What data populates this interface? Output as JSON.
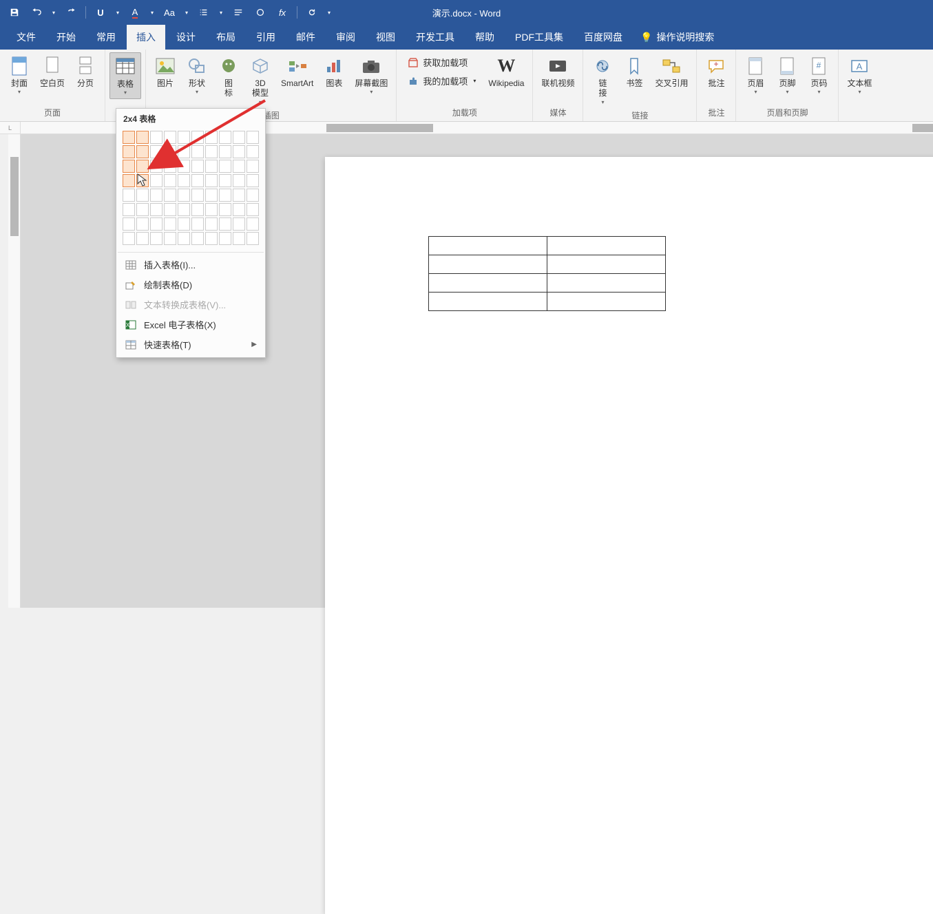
{
  "title": "演示.docx - Word",
  "qat_tooltips": {
    "save": "保存",
    "undo": "撤销",
    "redo": "重做"
  },
  "tabs": {
    "file": "文件",
    "home": "开始",
    "common": "常用",
    "insert": "插入",
    "design": "设计",
    "layout": "布局",
    "references": "引用",
    "mail": "邮件",
    "review": "审阅",
    "view": "视图",
    "developer": "开发工具",
    "help": "帮助",
    "pdf": "PDF工具集",
    "baidu": "百度网盘",
    "tellme": "操作说明搜索"
  },
  "ribbon": {
    "pages": {
      "cover": "封面",
      "blank": "空白页",
      "break": "分页",
      "group": "页面"
    },
    "tables": {
      "table": "表格",
      "group": ""
    },
    "illustrations": {
      "picture": "图片",
      "shapes": "形状",
      "icons": "图\n标",
      "model3d": "3D\n模型",
      "smartart": "SmartArt",
      "chart": "图表",
      "screenshot": "屏幕截图",
      "group": "插图"
    },
    "addins": {
      "get": "获取加载项",
      "my": "我的加载项",
      "wikipedia": "Wikipedia",
      "group": "加载项"
    },
    "media": {
      "video": "联机视频",
      "group": "媒体"
    },
    "links": {
      "link": "链\n接",
      "bookmark": "书签",
      "crossref": "交叉引用",
      "group": "链接"
    },
    "comments": {
      "comment": "批注",
      "group": "批注"
    },
    "headerfooter": {
      "header": "页眉",
      "footer": "页脚",
      "pagenum": "页码",
      "group": "页眉和页脚"
    },
    "text": {
      "textbox": "文本框"
    }
  },
  "table_dropdown": {
    "header": "2x4 表格",
    "selected_cols": 2,
    "selected_rows": 4,
    "grid_cols": 10,
    "grid_rows": 8,
    "insert_table": "插入表格(I)...",
    "draw_table": "绘制表格(D)",
    "convert_text": "文本转换成表格(V)...",
    "excel": "Excel 电子表格(X)",
    "quick": "快速表格(T)"
  },
  "doc_preview": {
    "cols": 2,
    "rows": 4
  }
}
